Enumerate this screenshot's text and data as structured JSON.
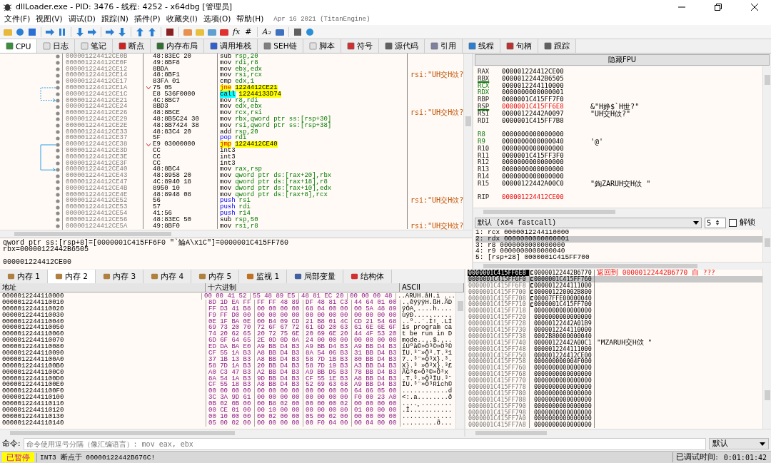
{
  "window": {
    "title": "dllLoader.exe - PID: 3476 - 线程: 4252 - x64dbg [管理员]"
  },
  "menu": [
    "文件(F)",
    "视图(V)",
    "调试(D)",
    "跟踪(N)",
    "插件(P)",
    "收藏夹(I)",
    "选项(O)",
    "帮助(H)"
  ],
  "build": "Apr 16 2021 (TitanEngine)",
  "toolbar": [
    {
      "kind": "icon"
    },
    {
      "kind": "icon"
    },
    {
      "kind": "icon"
    },
    {
      "kind": "sep"
    },
    {
      "kind": "icon"
    },
    {
      "kind": "icon"
    },
    {
      "kind": "sep"
    },
    {
      "kind": "icon"
    },
    {
      "kind": "icon"
    },
    {
      "kind": "sep"
    },
    {
      "kind": "icon"
    },
    {
      "kind": "icon"
    },
    {
      "kind": "sep"
    },
    {
      "kind": "icon"
    },
    {
      "kind": "icon"
    },
    {
      "kind": "sep"
    },
    {
      "kind": "icon"
    },
    {
      "kind": "sep"
    },
    {
      "kind": "icon"
    },
    {
      "kind": "icon"
    },
    {
      "kind": "icon"
    },
    {
      "kind": "icon"
    },
    {
      "kind": "text",
      "label": "fx"
    },
    {
      "kind": "text",
      "label": "#"
    },
    {
      "kind": "sep"
    },
    {
      "kind": "text",
      "label": "A₂"
    },
    {
      "kind": "icon"
    },
    {
      "kind": "sep"
    },
    {
      "kind": "icon"
    },
    {
      "kind": "icon"
    }
  ],
  "tabs": [
    {
      "label": "CPU",
      "selected": true
    },
    {
      "label": "日志",
      "selected": false
    },
    {
      "label": "笔记",
      "selected": false
    },
    {
      "label": "断点",
      "selected": false
    },
    {
      "label": "内存布局",
      "selected": false
    },
    {
      "label": "调用堆栈",
      "selected": false
    },
    {
      "label": "SEH链",
      "selected": false
    },
    {
      "label": "脚本",
      "selected": false
    },
    {
      "label": "符号",
      "selected": false
    },
    {
      "label": "源代码",
      "selected": false
    },
    {
      "label": "引用",
      "selected": false
    },
    {
      "label": "线程",
      "selected": false
    },
    {
      "label": "句柄",
      "selected": false
    },
    {
      "label": "跟踪",
      "selected": false
    }
  ],
  "disassembly": [
    {
      "addr": "000001224412CE0B",
      "bytes": "48:83EC 20",
      "kind": "plain",
      "mnemonic": "sub",
      "operands": "rsp,20"
    },
    {
      "addr": "000001224412CE0F",
      "bytes": "49:8BF8",
      "kind": "plain",
      "mnemonic": "mov",
      "operands": "rdi,r8"
    },
    {
      "addr": "000001224412CE12",
      "bytes": "8BDA",
      "kind": "plain",
      "mnemonic": "mov",
      "operands": "ebx,edx"
    },
    {
      "addr": "000001224412CE14",
      "bytes": "48:8BF1",
      "kind": "plain",
      "mnemonic": "mov",
      "operands": "rsi,rcx",
      "comment": "rsi:\"UH交H佽?"
    },
    {
      "addr": "000001224412CE17",
      "bytes": "83FA 01",
      "kind": "plain",
      "mnemonic": "cmp",
      "operands": "edx,1"
    },
    {
      "addr": "000001224412CE1A",
      "bytes": "75 05",
      "kind": "jump",
      "mnemonic": "jne",
      "operands": "1224412CE21",
      "jump_start": true,
      "dashed": true
    },
    {
      "addr": "000001224412CE1C",
      "bytes": "E8 536F0000",
      "kind": "call",
      "mnemonic": "call",
      "operands": "12244133D74"
    },
    {
      "addr": "000001224412CE21",
      "bytes": "4C:8BC7",
      "kind": "plain",
      "mnemonic": "mov",
      "operands": "r8,rdi",
      "jump_end": true
    },
    {
      "addr": "000001224412CE24",
      "bytes": "8BD3",
      "kind": "plain",
      "mnemonic": "mov",
      "operands": "edx,ebx"
    },
    {
      "addr": "000001224412CE26",
      "bytes": "48:8BCE",
      "kind": "plain",
      "mnemonic": "mov",
      "operands": "rcx,rsi",
      "comment": "rsi:\"UH交H佽?"
    },
    {
      "addr": "000001224412CE29",
      "bytes": "48:8B5C24 30",
      "kind": "plain",
      "mnemonic": "mov",
      "operands": "rbx,qword ptr ss:[rsp+30]"
    },
    {
      "addr": "000001224412CE2E",
      "bytes": "48:8B7424 38",
      "kind": "plain",
      "mnemonic": "mov",
      "operands": "rsi,qword ptr ss:[rsp+38]"
    },
    {
      "addr": "000001224412CE33",
      "bytes": "48:83C4 20",
      "kind": "plain",
      "mnemonic": "add",
      "operands": "rsp,20"
    },
    {
      "addr": "000001224412CE37",
      "bytes": "5F",
      "kind": "stack",
      "mnemonic": "pop",
      "operands": "rdi"
    },
    {
      "addr": "000001224412CE38",
      "bytes": "E9 03000000",
      "kind": "jump",
      "mnemonic": "jmp",
      "operands": "1224412CE40",
      "jump_start": true,
      "dashed": false
    },
    {
      "addr": "000001224412CE3D",
      "bytes": "CC",
      "kind": "plain",
      "mnemonic": "int3"
    },
    {
      "addr": "000001224412CE3E",
      "bytes": "CC",
      "kind": "plain",
      "mnemonic": "int3"
    },
    {
      "addr": "000001224412CE3F",
      "bytes": "CC",
      "kind": "plain",
      "mnemonic": "int3"
    },
    {
      "addr": "000001224412CE40",
      "bytes": "48:8BC4",
      "kind": "plain",
      "mnemonic": "mov",
      "operands": "rax,rsp",
      "jump_end": true
    },
    {
      "addr": "000001224412CE43",
      "bytes": "48:8958 20",
      "kind": "plain",
      "mnemonic": "mov",
      "operands": "qword ptr ds:[rax+20],rbx"
    },
    {
      "addr": "000001224412CE47",
      "bytes": "4C:8940 18",
      "kind": "plain",
      "mnemonic": "mov",
      "operands": "qword ptr ds:[rax+18],r8"
    },
    {
      "addr": "000001224412CE4B",
      "bytes": "8950 10",
      "kind": "plain",
      "mnemonic": "mov",
      "operands": "dword ptr ds:[rax+10],edx"
    },
    {
      "addr": "000001224412CE4E",
      "bytes": "48:8948 08",
      "kind": "plain",
      "mnemonic": "mov",
      "operands": "qword ptr ds:[rax+8],rcx"
    },
    {
      "addr": "000001224412CE52",
      "bytes": "56",
      "kind": "stack",
      "mnemonic": "push",
      "operands": "rsi",
      "comment": "rsi:\"UH交H佽?"
    },
    {
      "addr": "000001224412CE53",
      "bytes": "57",
      "kind": "stack",
      "mnemonic": "push",
      "operands": "rdi"
    },
    {
      "addr": "000001224412CE54",
      "bytes": "41:56",
      "kind": "stack",
      "mnemonic": "push",
      "operands": "r14"
    },
    {
      "addr": "000001224412CE56",
      "bytes": "48:83EC 50",
      "kind": "plain",
      "mnemonic": "sub",
      "operands": "rsp,50"
    },
    {
      "addr": "000001224412CE5A",
      "bytes": "49:8BF0",
      "kind": "plain",
      "mnemonic": "mov",
      "operands": "rsi,r8",
      "comment": "rsi:\"UH交H佽?"
    }
  ],
  "registers": {
    "header": "隐藏FPU",
    "groups": [
      [
        {
          "name": "RAX",
          "value": "000001224412CE00",
          "argument": false,
          "underlined": false,
          "modified": false
        },
        {
          "name": "RBX",
          "value": "00000122442B6505",
          "argument": false,
          "underlined": true,
          "modified": false
        },
        {
          "name": "RCX",
          "value": "0000012244110000",
          "argument": true,
          "underlined": false,
          "modified": false
        },
        {
          "name": "RDX",
          "value": "0000000000000001",
          "argument": true,
          "underlined": false,
          "modified": false
        },
        {
          "name": "RBP",
          "value": "0000001C415FF7F0",
          "argument": false,
          "underlined": false,
          "modified": false
        },
        {
          "name": "RSP",
          "value": "0000001C415FF6E8",
          "argument": false,
          "underlined": true,
          "modified": true,
          "comment": "&\"H婙$`H世?\""
        },
        {
          "name": "RSI",
          "value": "00000122442A0097",
          "argument": false,
          "underlined": false,
          "modified": false,
          "comment": "\"UH交H佽?\""
        },
        {
          "name": "RDI",
          "value": "0000001C415FF7B8",
          "argument": false,
          "underlined": false,
          "modified": false
        }
      ],
      [
        {
          "name": "R8",
          "value": "0000000000000000",
          "argument": true,
          "underlined": false,
          "modified": false
        },
        {
          "name": "R9",
          "value": "0000000000000040",
          "argument": true,
          "underlined": false,
          "modified": false,
          "comment": "'@'"
        },
        {
          "name": "R10",
          "value": "0000000000000000",
          "argument": false,
          "underlined": false,
          "modified": false
        },
        {
          "name": "R11",
          "value": "0000001C415FF3F0",
          "argument": false,
          "underlined": false,
          "modified": false
        },
        {
          "name": "R12",
          "value": "0000000000000000",
          "argument": false,
          "underlined": false,
          "modified": false
        },
        {
          "name": "R13",
          "value": "0000000000000000",
          "argument": false,
          "underlined": false,
          "modified": false
        },
        {
          "name": "R14",
          "value": "0000000000000000",
          "argument": false,
          "underlined": false,
          "modified": false
        },
        {
          "name": "R15",
          "value": "00000122442A00C0",
          "argument": false,
          "underlined": false,
          "modified": false,
          "comment": "\"鋾ZARUH交H佽 \""
        }
      ],
      [
        {
          "name": "RIP",
          "value": "000001224412CE00",
          "argument": false,
          "underlined": false,
          "modified": true
        }
      ]
    ]
  },
  "call_convention": {
    "value": "默认 (x64 fastcall)",
    "count": "5",
    "unlock_label": "解锁",
    "unlocked": false,
    "args": [
      {
        "text": "1: rcx 0000012244110000",
        "selected": false
      },
      {
        "text": "2: rdx 0000000000000001",
        "selected": true
      },
      {
        "text": "3: r8 0000000000000000",
        "selected": false
      },
      {
        "text": "4: r9 0000000000000040",
        "selected": false
      },
      {
        "text": "5: [rsp+28] 0000001C415FF700",
        "selected": false
      }
    ]
  },
  "info": {
    "lines": [
      "qword ptr ss:[rsp+8]=[0000001C415FF6F0 \"`鯩A\\x1C\"]=0000001C415FF760",
      "rbx=00000122442B6505"
    ],
    "address": "000001224412CE00"
  },
  "memory_tabs": [
    {
      "label": "内存 1",
      "selected": false
    },
    {
      "label": "内存 2",
      "selected": true
    },
    {
      "label": "内存 3",
      "selected": false
    },
    {
      "label": "内存 4",
      "selected": false
    },
    {
      "label": "内存 5",
      "selected": false
    },
    {
      "label": "监视 1",
      "selected": false
    },
    {
      "label": "局部变量",
      "selected": false
    },
    {
      "label": "结构体",
      "selected": false
    }
  ],
  "dump": {
    "columns": [
      "地址",
      "十六进制",
      "ASCII"
    ],
    "rows": [
      {
        "addr": "0000012244110000",
        "hex": [
          "00 00 41 52",
          "55 48 89 E5",
          "48 81 EC 20",
          "00 00 00 48"
        ],
        "ascii": "..ARUH.åH.ì ..."
      },
      {
        "addr": "0000012244110010",
        "hex": [
          "8D 1D EA FF",
          "FF FF 48 89",
          "DF 48 81 C3",
          "44 64 01 00"
        ],
        "ascii": "..êÿÿÿH.ßH.ÃD"
      },
      {
        "addr": "0000012244110020",
        "hex": [
          "FF D3 41 B8",
          "00 00 00 00",
          "68 04 00 00",
          "00 5A 48 89"
        ],
        "ascii": "ÿÓA¸....h...."
      },
      {
        "addr": "0000012244110030",
        "hex": [
          "F9 FF D0 00",
          "00 00 00 00",
          "00 00 00 00",
          "00 00 00 00"
        ],
        "ascii": "ùÿÐ.........."
      },
      {
        "addr": "0000012244110040",
        "hex": [
          "0E 1F BA 0E",
          "00 B4 09 CD",
          "21 B8 01 4C",
          "CD 21 54 68"
        ],
        "ascii": "..º..´.Í!¸.LÍ"
      },
      {
        "addr": "0000012244110050",
        "hex": [
          "69 73 20 70",
          "72 6F 67 72",
          "61 6D 20 63",
          "61 6E 6E 6F"
        ],
        "ascii": "is program ca"
      },
      {
        "addr": "0000012244110060",
        "hex": [
          "74 20 62 65",
          "20 72 75 6E",
          "20 69 6E 20",
          "44 4F 53 20"
        ],
        "ascii": "t be run in D"
      },
      {
        "addr": "0000012244110070",
        "hex": [
          "6D 6F 64 65",
          "2E 0D 0D 0A",
          "24 00 00 00",
          "00 00 00 00"
        ],
        "ascii": "mode....$...."
      },
      {
        "addr": "0000012244110080",
        "hex": [
          "ED DA BA E0",
          "A9 BB D4 B3",
          "A9 BB D4 B3",
          "A9 BB D4 B3"
        ],
        "ascii": "íÚºà©»Ô³©»Ô³©"
      },
      {
        "addr": "0000012244110090",
        "hex": [
          "CF 55 1A B3",
          "A8 BB D4 B3",
          "8A 54 06 B3",
          "31 BB D4 B3"
        ],
        "ascii": "ÏU.³¨»Ô³.T.³1"
      },
      {
        "addr": "00000122441100A0",
        "hex": [
          "37 1B 13 B3",
          "A8 BB D4 B3",
          "58 7D 1B B3",
          "80 BB D4 B3"
        ],
        "ascii": "7..³¨»Ô³X}.³."
      },
      {
        "addr": "00000122441100B0",
        "hex": [
          "58 7D 1A B3",
          "20 BB D4 B3",
          "58 7D 19 B3",
          "A3 BB D4 B3"
        ],
        "ascii": "X}.³ »Ô³X}.³£"
      },
      {
        "addr": "00000122441100C0",
        "hex": [
          "A0 C3 47 B3",
          "A2 BB D4 B3",
          "A9 BB D5 B3",
          "78 BB D4 B3"
        ],
        "ascii": " ÃG³¢»Ô³©»Õ³x"
      },
      {
        "addr": "00000122441100D0",
        "hex": [
          "8A 54 1A B3",
          "9D BB D4 B3",
          "CF 55 1E B3",
          "A8 BB D4 B3"
        ],
        "ascii": ".T.³.»Ô³ÏU.³¨"
      },
      {
        "addr": "00000122441100E0",
        "hex": [
          "CF 55 18 B3",
          "A8 BB D4 B3",
          "52 69 63 68",
          "A9 BB D4 B3"
        ],
        "ascii": "ÏU.³¨»Ô³Rich©"
      },
      {
        "addr": "00000122441100F0",
        "hex": [
          "00 00 00 00",
          "00 00 00 00",
          "00 00 00 00",
          "64 86 05 00"
        ],
        "ascii": "............d"
      },
      {
        "addr": "0000012244110100",
        "hex": [
          "3C 3A 9D 61",
          "00 00 00 00",
          "00 00 00 00",
          "F0 00 23 A0"
        ],
        "ascii": "<:.a........ð"
      },
      {
        "addr": "0000012244110110",
        "hex": [
          "0B 02 0B 00",
          "00 B8 02 00",
          "00 00 00 02",
          "00 00 00 00"
        ],
        "ascii": "....¸........"
      },
      {
        "addr": "0000012244110120",
        "hex": [
          "00 CE 01 00",
          "00 10 00 00",
          "00 00 00 80",
          "01 00 00 00"
        ],
        "ascii": ".Î..........."
      },
      {
        "addr": "0000012244110130",
        "hex": [
          "00 10 00 00",
          "00 02 00 00",
          "05 00 02 00",
          "00 00 00 00"
        ],
        "ascii": "............."
      },
      {
        "addr": "0000012244110140",
        "hex": [
          "05 00 02 00",
          "00 00 00 00",
          "00 F0 04 00",
          "00 04 00 00"
        ],
        "ascii": ".........ð..."
      }
    ]
  },
  "stack": [
    {
      "addr": "0000001C415FF6E8",
      "value": "00000122442B6770",
      "comment": "返回到 00000122442B6770 自 ???",
      "current": true,
      "selected": false,
      "frame_mark": true
    },
    {
      "addr": "0000001C415FF6F0",
      "value": "0000001C415FF760",
      "current": false,
      "selected": true,
      "frame_mark": true
    },
    {
      "addr": "0000001C415FF6F8",
      "value": "0000012244111000",
      "current": false,
      "selected": false,
      "frame_mark": true
    },
    {
      "addr": "0000001C415FF700",
      "value": "000001220002B800",
      "current": false,
      "selected": false,
      "frame_mark": true
    },
    {
      "addr": "0000001C415FF708",
      "value": "00007FFE00000040",
      "current": false,
      "selected": false,
      "frame_mark": true
    },
    {
      "addr": "0000001C415FF710",
      "value": "0000001C415FF700",
      "current": false,
      "selected": false,
      "frame_mark": true
    },
    {
      "addr": "0000001C415FF718",
      "value": "0000000000000000",
      "current": false,
      "selected": false,
      "frame_mark": false
    },
    {
      "addr": "0000001C415FF720",
      "value": "0000000000000000",
      "current": false,
      "selected": false,
      "frame_mark": false
    },
    {
      "addr": "0000001C415FF728",
      "value": "00000122442A01B9",
      "current": false,
      "selected": false,
      "frame_mark": false
    },
    {
      "addr": "0000001C415FF730",
      "value": "0000012244110000",
      "current": false,
      "selected": false,
      "frame_mark": false
    },
    {
      "addr": "0000001C415FF738",
      "value": "0002B80000000040",
      "current": false,
      "selected": false,
      "frame_mark": false
    },
    {
      "addr": "0000001C415FF740",
      "value": "00000122442A00C1",
      "comment": "\"MZARUH交H佽 \"",
      "current": false,
      "selected": false,
      "frame_mark": false
    },
    {
      "addr": "0000001C415FF748",
      "value": "0000012244111000",
      "current": false,
      "selected": false,
      "frame_mark": false
    },
    {
      "addr": "0000001C415FF750",
      "value": "000001224412CE00",
      "current": false,
      "selected": false,
      "frame_mark": false
    },
    {
      "addr": "0000001C415FF758",
      "value": "000000000004F000",
      "current": false,
      "selected": false,
      "frame_mark": false
    },
    {
      "addr": "0000001C415FF760",
      "value": "0000000000000000",
      "current": false,
      "selected": false,
      "frame_mark": false
    },
    {
      "addr": "0000001C415FF768",
      "value": "0000000000000000",
      "current": false,
      "selected": false,
      "frame_mark": false
    },
    {
      "addr": "0000001C415FF770",
      "value": "0000000000000000",
      "current": false,
      "selected": false,
      "frame_mark": false
    },
    {
      "addr": "0000001C415FF778",
      "value": "0000000000000000",
      "current": false,
      "selected": false,
      "frame_mark": false
    },
    {
      "addr": "0000001C415FF780",
      "value": "0000000000000000",
      "current": false,
      "selected": false,
      "frame_mark": false
    },
    {
      "addr": "0000001C415FF788",
      "value": "0000000000000000",
      "current": false,
      "selected": false,
      "frame_mark": false
    },
    {
      "addr": "0000001C415FF790",
      "value": "0000000000000000",
      "current": false,
      "selected": false,
      "frame_mark": false
    },
    {
      "addr": "0000001C415FF798",
      "value": "0000000000000000",
      "current": false,
      "selected": false,
      "frame_mark": false
    },
    {
      "addr": "0000001C415FF7A0",
      "value": "0000000000000000",
      "current": false,
      "selected": false,
      "frame_mark": false
    },
    {
      "addr": "0000001C415FF7A8",
      "value": "0000000000000000",
      "current": false,
      "selected": false,
      "frame_mark": false
    }
  ],
  "command": {
    "label": "命令:",
    "placeholder": "命令使用逗号分隔（像汇编语言）: mov eax, ebx",
    "mode": "默认"
  },
  "status_bar": {
    "state": "已暂停",
    "message": "INT3 断点于 00000122442B676C!",
    "time_label": "已调试时间:",
    "time": "0:01:01:42"
  }
}
